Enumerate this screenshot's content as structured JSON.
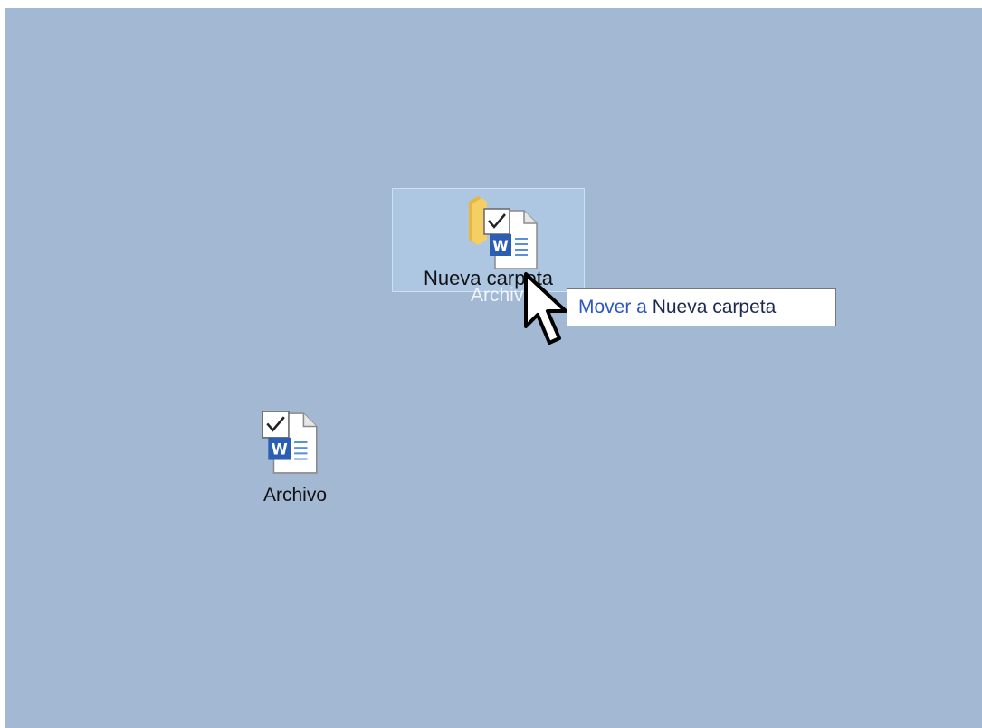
{
  "desktop": {
    "background_color": "#a3b8d3",
    "folder": {
      "label": "Nueva carpeta",
      "icon": "folder-icon",
      "state": "drop-target-highlighted"
    },
    "file": {
      "label": "Archivo",
      "icon": "word-document-icon"
    },
    "drag_ghost": {
      "label": "Archivo",
      "icon": "word-document-icon"
    }
  },
  "tooltip": {
    "verb": "Mover a",
    "target": "Nueva carpeta"
  },
  "cursor": {
    "icon": "arrow-cursor-icon"
  },
  "colors": {
    "tooltip_verb": "#2b56c8",
    "word_blue": "#2b5eb3",
    "folder_yellow": "#f4cf63"
  }
}
